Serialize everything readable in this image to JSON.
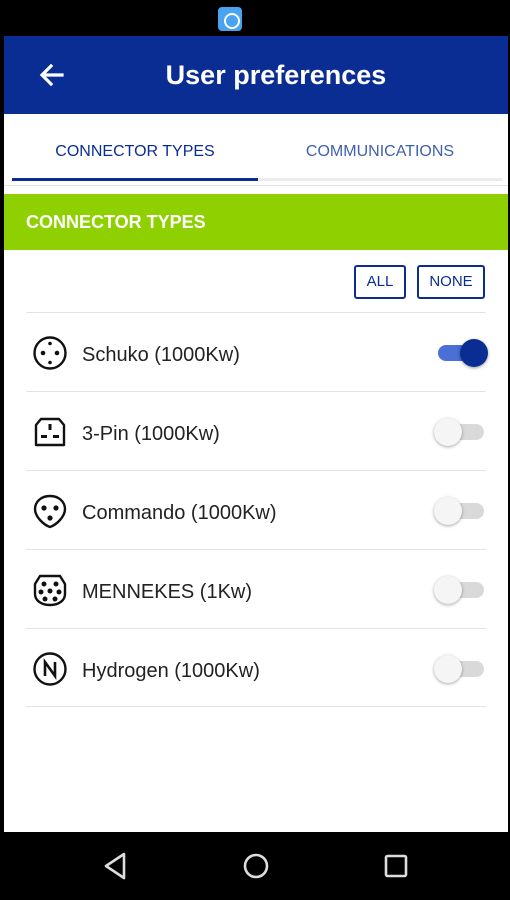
{
  "app_bar": {
    "title": "User preferences",
    "back_icon": "arrow-left-icon"
  },
  "tabs": [
    {
      "label": "CONNECTOR TYPES",
      "selected": true
    },
    {
      "label": "COMMUNICATIONS",
      "selected": false
    }
  ],
  "section": {
    "title": "CONNECTOR TYPES",
    "actions": {
      "all_label": "ALL",
      "none_label": "NONE"
    }
  },
  "connectors": [
    {
      "label": "Schuko (1000Kw)",
      "icon": "schuko-plug-icon",
      "enabled": true
    },
    {
      "label": "3-Pin (1000Kw)",
      "icon": "three-pin-plug-icon",
      "enabled": false
    },
    {
      "label": "Commando (1000Kw)",
      "icon": "commando-plug-icon",
      "enabled": false
    },
    {
      "label": "MENNEKES (1Kw)",
      "icon": "mennekes-plug-icon",
      "enabled": false
    },
    {
      "label": "Hydrogen (1000Kw)",
      "icon": "hydrogen-nozzle-icon",
      "enabled": false
    }
  ],
  "colors": {
    "app_bar": "#0a2d94",
    "section_header": "#8fd100",
    "toggle_on": "#0a2d94"
  }
}
